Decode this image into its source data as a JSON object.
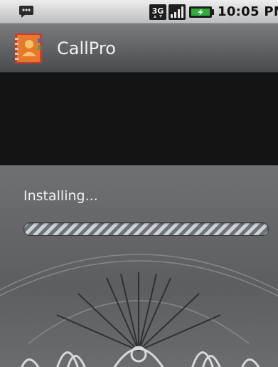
{
  "status_bar": {
    "time": "10:05 PM",
    "network": "3G",
    "icons": [
      "chat-notification-icon",
      "3g-icon",
      "signal-icon",
      "battery-icon"
    ]
  },
  "title_bar": {
    "app_name": "CallPro",
    "icon": "callpro-app-icon"
  },
  "install": {
    "label": "Installing...",
    "progress": "indeterminate"
  },
  "colors": {
    "title_bar": "#5e6061",
    "dark_band": "#141414",
    "background": "#666869",
    "progress_light": "#cfd2d6",
    "progress_dark": "#6d7378",
    "app_icon_orange": "#e8782a",
    "app_icon_red": "#d03a2a"
  }
}
